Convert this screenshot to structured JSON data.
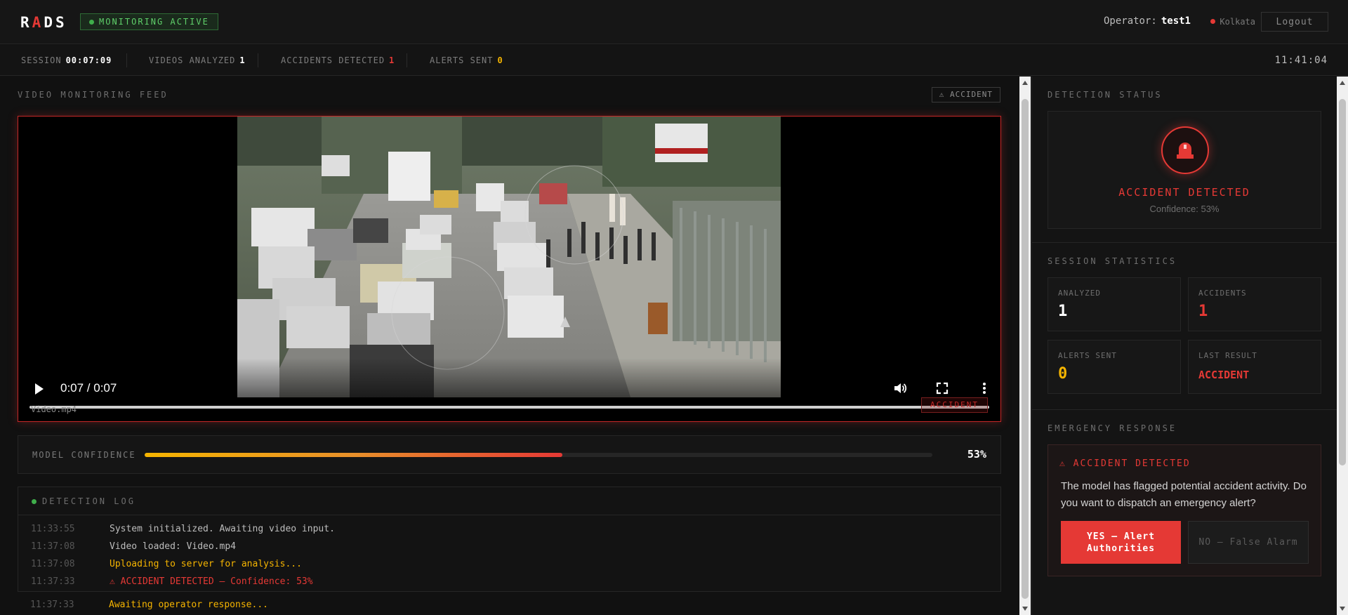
{
  "header": {
    "logo_pre": "R",
    "logo_accent": "A",
    "logo_post": "DS",
    "monitor_status": "MONITORING ACTIVE",
    "operator_label": "Operator:",
    "operator_name": "test1",
    "location": "Kolkata",
    "logout_label": "Logout"
  },
  "stats_bar": {
    "session_label": "SESSION",
    "session_value": "00:07:09",
    "videos_label": "VIDEOS ANALYZED",
    "videos_value": "1",
    "accidents_label": "ACCIDENTS DETECTED",
    "accidents_value": "1",
    "alerts_label": "ALERTS SENT",
    "alerts_value": "0",
    "clock": "11:41:04"
  },
  "feed": {
    "title": "VIDEO MONITORING FEED",
    "tag": "⚠ ACCIDENT",
    "time_display": "0:07 / 0:07",
    "playback_progress": 1.0,
    "filename": "Video.mp4",
    "overlay_tag": "ACCIDENT"
  },
  "confidence": {
    "label": "MODEL CONFIDENCE",
    "value_text": "53%",
    "value": 0.53
  },
  "log": {
    "title": "DETECTION LOG",
    "entries": [
      {
        "time": "11:33:55",
        "message": "System initialized. Awaiting video input.",
        "level": "info"
      },
      {
        "time": "11:37:08",
        "message": "Video loaded: Video.mp4",
        "level": "info"
      },
      {
        "time": "11:37:08",
        "message": "Uploading to server for analysis...",
        "level": "warn"
      },
      {
        "time": "11:37:33",
        "message": "⚠ ACCIDENT DETECTED — Confidence: 53%",
        "level": "alert"
      },
      {
        "time": "11:37:33",
        "message": "Awaiting operator response...",
        "level": "warn"
      }
    ]
  },
  "detection": {
    "title": "DETECTION STATUS",
    "status": "ACCIDENT DETECTED",
    "confidence_text": "Confidence: 53%"
  },
  "session_stats": {
    "title": "SESSION STATISTICS",
    "analyzed_label": "ANALYZED",
    "analyzed_value": "1",
    "accidents_label": "ACCIDENTS",
    "accidents_value": "1",
    "alerts_label": "ALERTS SENT",
    "alerts_value": "0",
    "last_label": "LAST RESULT",
    "last_value": "ACCIDENT"
  },
  "emergency": {
    "title": "EMERGENCY RESPONSE",
    "head": "⚠ ACCIDENT DETECTED",
    "text": "The model has flagged potential accident activity. Do you want to dispatch an emergency alert?",
    "yes_label": "YES — Alert Authorities",
    "no_label": "NO — False Alarm"
  },
  "colors": {
    "accent_red": "#e53935",
    "amber": "#f5b400",
    "green": "#3fae4b",
    "bg": "#111111"
  }
}
